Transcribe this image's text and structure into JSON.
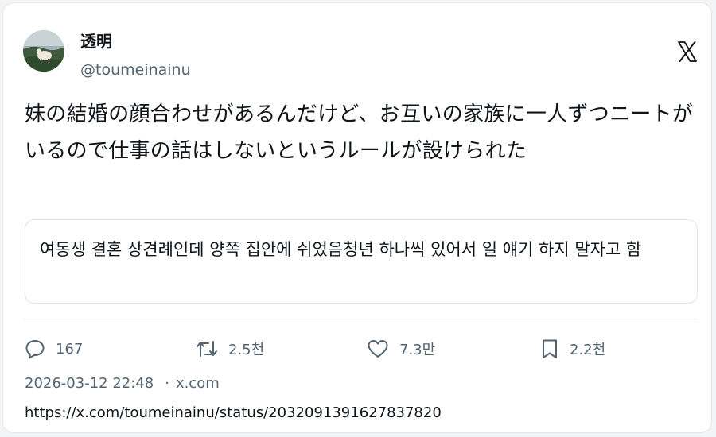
{
  "author": {
    "display_name": "透明",
    "handle": "@toumeinainu"
  },
  "post": {
    "text": "妹の結婚の顔合わせがあるんだけど、お互いの家族に一人ずつニートがいるので仕事の話はしないというルールが設けられた",
    "translation": "여동생 결혼 상견례인데 양쪽 집안에 쉬었음청년 하나씩 있어서 일 얘기 하지 말자고 함"
  },
  "actions": {
    "replies": "167",
    "reposts": "2.5천",
    "likes": "7.3만",
    "bookmarks": "2.2천"
  },
  "meta": {
    "timestamp": "2026-03-12 22:48",
    "separator": "·",
    "source": "x.com",
    "url": "https://x.com/toumeinainu/status/2032091391627837820"
  },
  "icons": {
    "logo": "x-logo-icon",
    "reply": "reply-icon",
    "repost": "repost-icon",
    "like": "heart-icon",
    "bookmark": "bookmark-icon"
  },
  "colors": {
    "text": "#0f1419",
    "muted": "#536471",
    "border": "#e4e7ea"
  }
}
